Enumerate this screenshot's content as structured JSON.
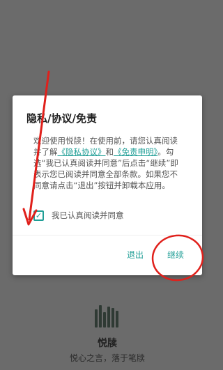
{
  "dialog": {
    "title": "隐私/协议/免责",
    "body_intro": "欢迎使用悦牍！在使用前，请您认真阅读并了解",
    "privacy_link": "《隐私协议》",
    "and": "和",
    "disclaimer_link": "《免责申明》",
    "body_rest": "。勾选“我已认真阅读并同意”后点击“继续”即表示您已阅读并同意全部条款。如果您不同意请点击“退出”按钮并卸载本应用。",
    "checkbox_label": "我已认真阅读并同意",
    "checkbox_checked": true,
    "exit_label": "退出",
    "continue_label": "继续"
  },
  "splash": {
    "app_name": "悦牍",
    "slogan": "悦心之言，落于笔牍"
  },
  "colors": {
    "accent": "#1f9e96",
    "scrim": "#6b6b6b",
    "annotation": "#e0201b"
  }
}
